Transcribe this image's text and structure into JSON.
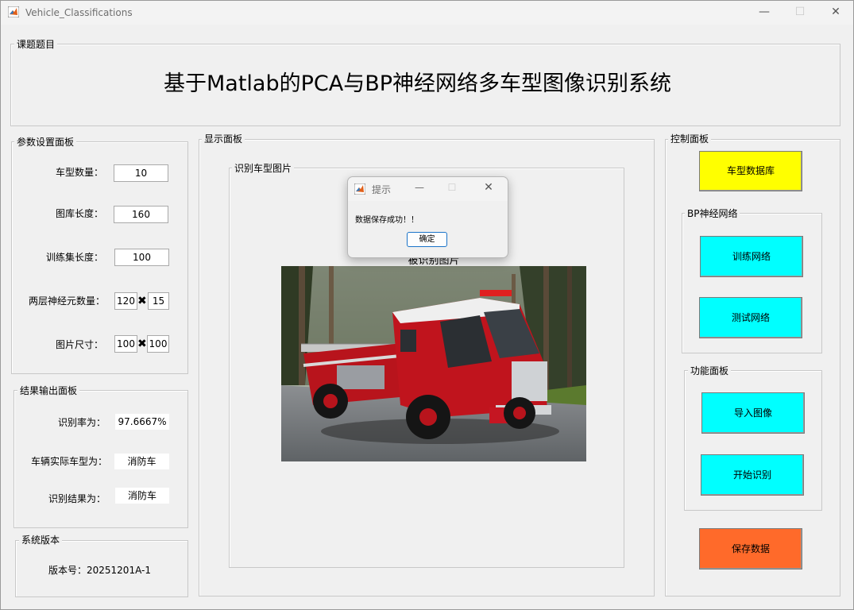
{
  "window": {
    "title": "Vehicle_Classifications",
    "minimize": "—",
    "maximize": "☐",
    "close": "✕"
  },
  "topic": {
    "group_title": "课题题目",
    "main_title": "基于Matlab的PCA与BP神经网络多车型图像识别系统"
  },
  "params": {
    "group_title": "参数设置面板",
    "rows": [
      {
        "label": "车型数量：",
        "value": "10"
      },
      {
        "label": "图库长度：",
        "value": "160"
      },
      {
        "label": "训练集长度：",
        "value": "100"
      }
    ],
    "neurons": {
      "label": "两层神经元数量：",
      "value1": "120",
      "sep": "✖",
      "value2": "15"
    },
    "image_size": {
      "label": "图片尺寸：",
      "value1": "100",
      "sep": "✖",
      "value2": "100"
    }
  },
  "results": {
    "group_title": "结果输出面板",
    "rows": [
      {
        "label": "识别率为：",
        "value": "97.6667%"
      },
      {
        "label": "车辆实际车型为：",
        "value": "消防车"
      },
      {
        "label": "识别结果为：",
        "value": "消防车"
      }
    ]
  },
  "version": {
    "group_title": "系统版本",
    "text": "版本号：20251201A-1"
  },
  "display": {
    "group_title": "显示面板",
    "subgroup_title": "识别车型图片",
    "image_title": "被识别图片",
    "image_alt": "消防车"
  },
  "control": {
    "group_title": "控制面板",
    "db_button": "车型数据库",
    "bp_group_title": "BP神经网络",
    "train_button": "训练网络",
    "test_button": "测试网络",
    "func_group_title": "功能面板",
    "import_button": "导入图像",
    "recognize_button": "开始识别",
    "save_button": "保存数据"
  },
  "dialog": {
    "title": "提示",
    "message": "数据保存成功！！",
    "ok_label": "确定",
    "minimize": "—",
    "maximize": "☐",
    "close": "✕"
  },
  "colors": {
    "yellow": "#ffff00",
    "cyan": "#00ffff",
    "orange": "#ff6a2a",
    "panel_bg": "#f0f0f0"
  }
}
